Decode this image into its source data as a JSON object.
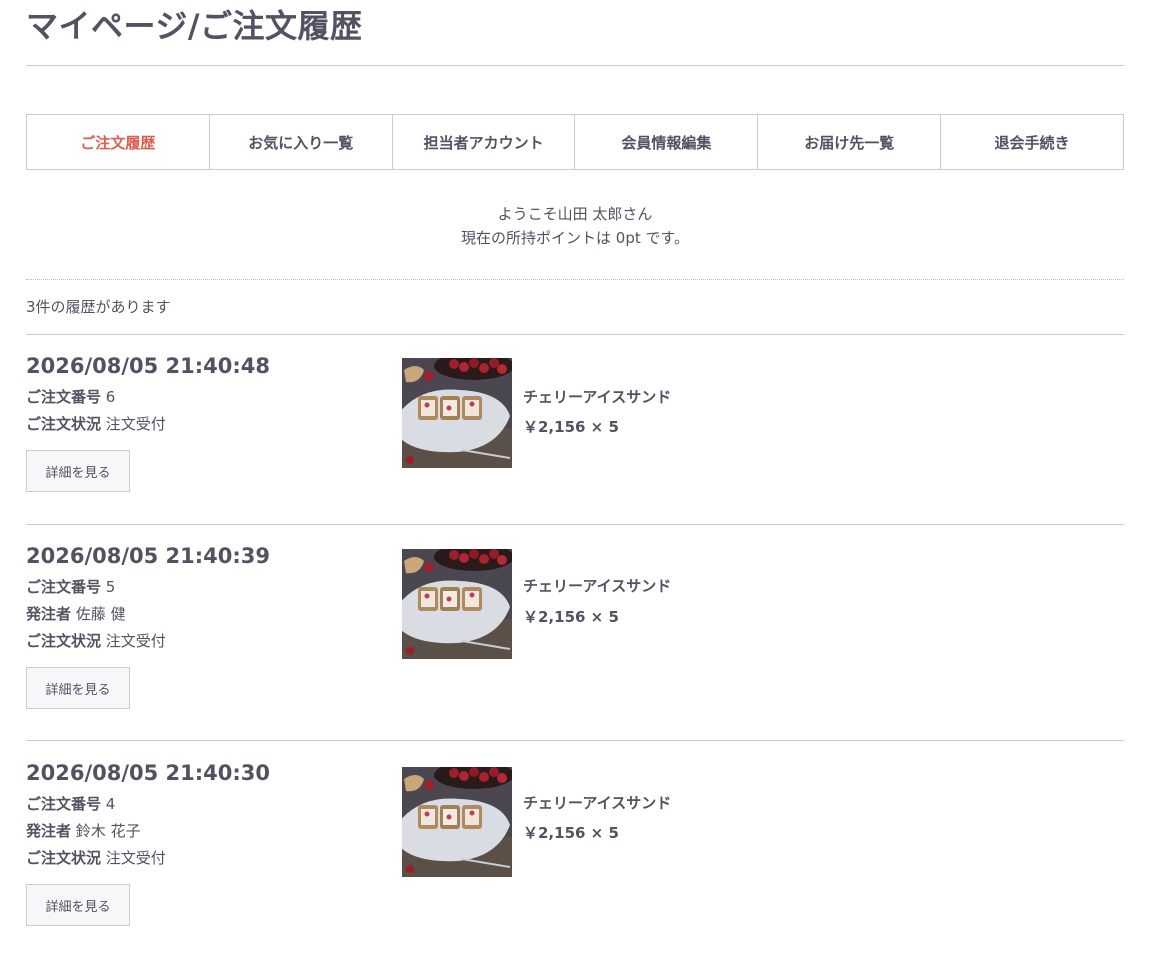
{
  "page": {
    "title": "マイページ/ご注文履歴"
  },
  "tabs": [
    {
      "label": "ご注文履歴",
      "active": true
    },
    {
      "label": "お気に入り一覧",
      "active": false
    },
    {
      "label": "担当者アカウント",
      "active": false
    },
    {
      "label": "会員情報編集",
      "active": false
    },
    {
      "label": "お届け先一覧",
      "active": false
    },
    {
      "label": "退会手続き",
      "active": false
    }
  ],
  "welcome": {
    "line1": "ようこそ山田 太郎さん",
    "line2": "現在の所持ポイントは 0pt です。"
  },
  "history": {
    "count_text": "3件の履歴があります"
  },
  "labels": {
    "order_no": "ご注文番号",
    "orderer": "発注者",
    "status": "ご注文状況",
    "detail_button": "詳細を見る"
  },
  "orders": [
    {
      "datetime": "2026/08/05 21:40:48",
      "order_no": "6",
      "status": "注文受付",
      "item": {
        "name": "チェリーアイスサンド",
        "price": "￥2,156 × 5",
        "image_icon": "cherry-ice-sandwich-photo"
      }
    },
    {
      "datetime": "2026/08/05 21:40:39",
      "order_no": "5",
      "orderer": "佐藤 健",
      "status": "注文受付",
      "item": {
        "name": "チェリーアイスサンド",
        "price": "￥2,156 × 5",
        "image_icon": "cherry-ice-sandwich-photo"
      }
    },
    {
      "datetime": "2026/08/05 21:40:30",
      "order_no": "4",
      "orderer": "鈴木 花子",
      "status": "注文受付",
      "item": {
        "name": "チェリーアイスサンド",
        "price": "￥2,156 × 5",
        "image_icon": "cherry-ice-sandwich-photo"
      }
    }
  ],
  "colors": {
    "text": "#525263",
    "accent": "#de5d50",
    "border": "#cccccc",
    "button_bg": "#f5f7f8"
  }
}
